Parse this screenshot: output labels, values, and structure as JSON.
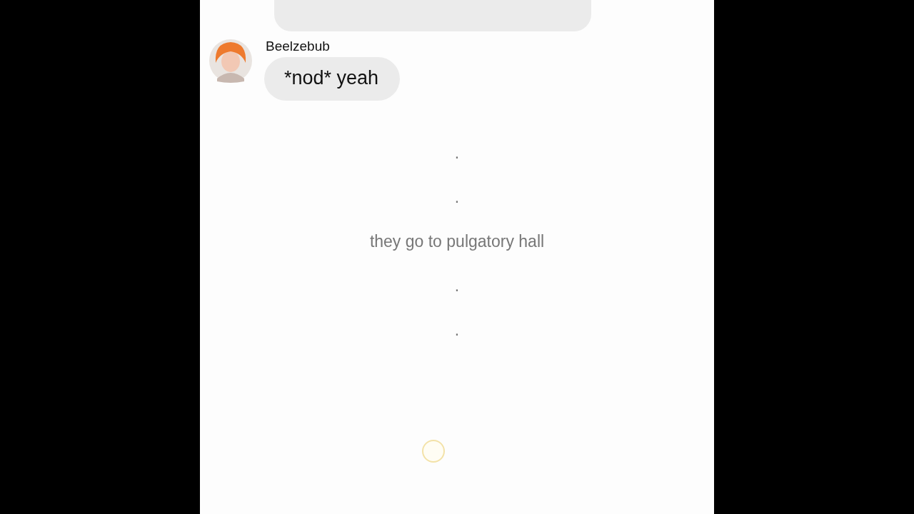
{
  "messages": [
    {
      "kind": "cut_bubble"
    },
    {
      "kind": "message",
      "sender": "Beelzebub",
      "text": "*nod* yeah"
    },
    {
      "kind": "narration",
      "text": "."
    },
    {
      "kind": "narration",
      "text": "."
    },
    {
      "kind": "narration",
      "text": "they go to pulgatory hall"
    },
    {
      "kind": "narration",
      "text": "."
    },
    {
      "kind": "narration",
      "text": "."
    }
  ]
}
